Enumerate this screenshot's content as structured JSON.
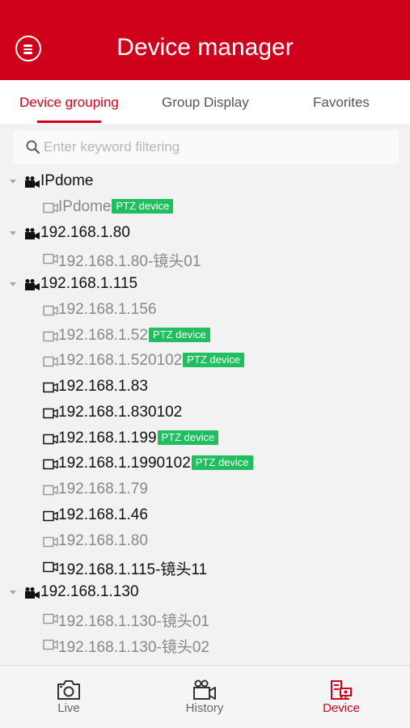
{
  "header": {
    "title": "Device manager",
    "menu_icon": "menu-icon"
  },
  "tabs": [
    {
      "label": "Device grouping",
      "active": true
    },
    {
      "label": "Group Display",
      "active": false
    },
    {
      "label": "Favorites",
      "active": false
    }
  ],
  "search": {
    "placeholder": "Enter keyword filtering",
    "value": ""
  },
  "ptz_badge": "PTZ device",
  "tree": [
    {
      "type": "group",
      "label": "IPdome"
    },
    {
      "type": "device",
      "label": "IPdome",
      "online": false,
      "ptz": true
    },
    {
      "type": "group",
      "label": "192.168.1.80"
    },
    {
      "type": "device",
      "label": "192.168.1.80-镜头01",
      "online": false,
      "ptz": false
    },
    {
      "type": "group",
      "label": "192.168.1.115"
    },
    {
      "type": "device",
      "label": "192.168.1.156",
      "online": false,
      "ptz": false
    },
    {
      "type": "device",
      "label": "192.168.1.52",
      "online": false,
      "ptz": true
    },
    {
      "type": "device",
      "label": "192.168.1.520102",
      "online": false,
      "ptz": true
    },
    {
      "type": "device",
      "label": "192.168.1.83",
      "online": true,
      "ptz": false
    },
    {
      "type": "device",
      "label": "192.168.1.830102",
      "online": true,
      "ptz": false
    },
    {
      "type": "device",
      "label": "192.168.1.199",
      "online": true,
      "ptz": true
    },
    {
      "type": "device",
      "label": "192.168.1.1990102",
      "online": true,
      "ptz": true
    },
    {
      "type": "device",
      "label": "192.168.1.79",
      "online": false,
      "ptz": false
    },
    {
      "type": "device",
      "label": "192.168.1.46",
      "online": true,
      "ptz": false
    },
    {
      "type": "device",
      "label": "192.168.1.80",
      "online": false,
      "ptz": false
    },
    {
      "type": "device",
      "label": "192.168.1.115-镜头11",
      "online": true,
      "ptz": false
    },
    {
      "type": "group",
      "label": "192.168.1.130"
    },
    {
      "type": "device",
      "label": "192.168.1.130-镜头01",
      "online": false,
      "ptz": false
    },
    {
      "type": "device",
      "label": "192.168.1.130-镜头02",
      "online": false,
      "ptz": false
    }
  ],
  "bottom_nav": [
    {
      "label": "Live",
      "icon": "camera-icon",
      "active": false
    },
    {
      "label": "History",
      "icon": "video-camera-icon",
      "active": false
    },
    {
      "label": "Device",
      "icon": "device-manager-icon",
      "active": true
    }
  ],
  "colors": {
    "brand": "#d0021b",
    "ptz": "#1fbf5f",
    "offline": "#888888",
    "online": "#111111"
  }
}
